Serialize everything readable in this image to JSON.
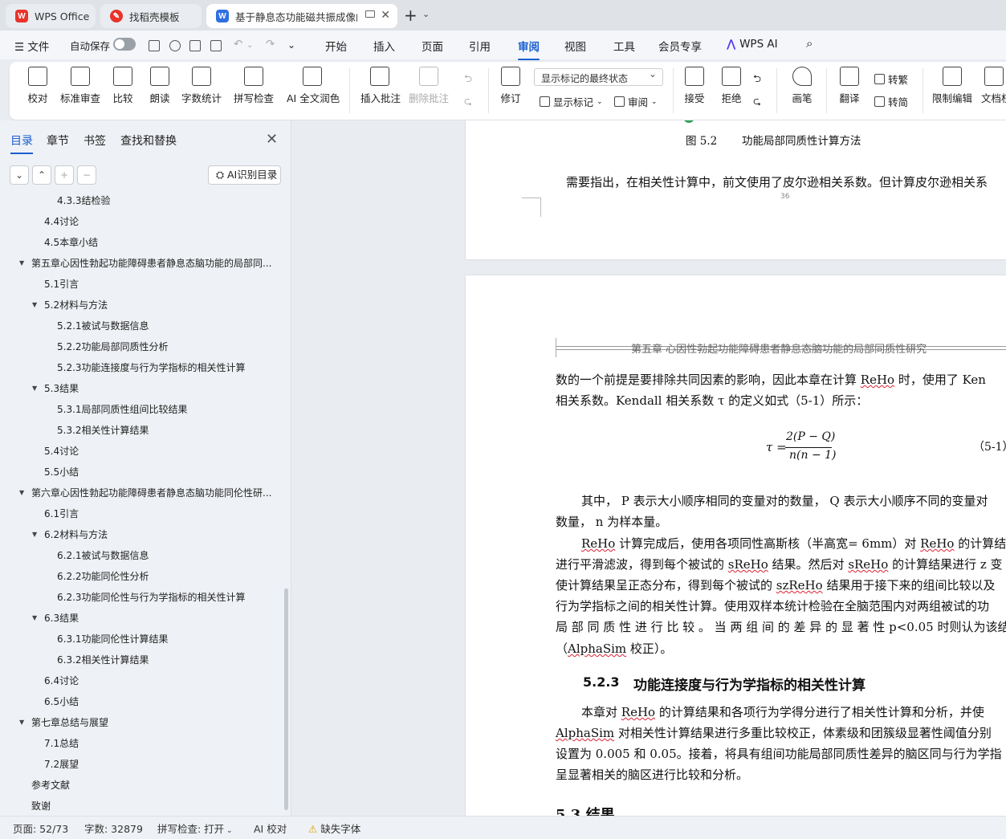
{
  "tabs": {
    "wps": "WPS Office",
    "template": "找稻壳模板",
    "doc": "基于静息态功能磁共振成像的",
    "new": "+"
  },
  "menu": {
    "file": "文件",
    "autosave": "自动保存",
    "items": [
      "开始",
      "插入",
      "页面",
      "引用",
      "审阅",
      "视图",
      "工具",
      "会员专享"
    ],
    "ai": "WPS AI"
  },
  "ribbon": {
    "proof": "校对",
    "std": "标准审查",
    "compare": "比较",
    "read": "朗读",
    "wordcount": "字数统计",
    "spell": "拼写检查",
    "ai_polish": "AI 全文润色",
    "insert_comment": "插入批注",
    "delete_comment": "删除批注",
    "track": "修订",
    "show_state": "显示标记的最终状态",
    "show_marks": "显示标记",
    "review": "审阅",
    "accept": "接受",
    "reject": "拒绝",
    "pen": "画笔",
    "translate": "翻译",
    "to_trad": "转繁",
    "to_simp": "转简",
    "restrict": "限制编辑",
    "protect": "文档权"
  },
  "sidebar": {
    "tabs": [
      "目录",
      "章节",
      "书签",
      "查找和替换"
    ],
    "ai_btn": "AI识别目录",
    "toc": [
      {
        "text": "4.3.3结检验",
        "level": 3
      },
      {
        "text": "4.4讨论",
        "level": 2
      },
      {
        "text": "4.5本章小结",
        "level": 2
      },
      {
        "text": "第五章心因性勃起功能障碍患者静息态脑功能的局部同...",
        "level": 1,
        "exp": true
      },
      {
        "text": "5.1引言",
        "level": 2
      },
      {
        "text": "5.2材料与方法",
        "level": 2,
        "exp": true
      },
      {
        "text": "5.2.1被试与数据信息",
        "level": 3
      },
      {
        "text": "5.2.2功能局部同质性分析",
        "level": 3
      },
      {
        "text": "5.2.3功能连接度与行为学指标的相关性计算",
        "level": 3
      },
      {
        "text": "5.3结果",
        "level": 2,
        "exp": true
      },
      {
        "text": "5.3.1局部同质性组间比较结果",
        "level": 3
      },
      {
        "text": "5.3.2相关性计算结果",
        "level": 3
      },
      {
        "text": "5.4讨论",
        "level": 2
      },
      {
        "text": "5.5小结",
        "level": 2
      },
      {
        "text": "第六章心因性勃起功能障碍患者静息态脑功能同伦性研...",
        "level": 1,
        "exp": true
      },
      {
        "text": "6.1引言",
        "level": 2
      },
      {
        "text": "6.2材料与方法",
        "level": 2,
        "exp": true
      },
      {
        "text": "6.2.1被试与数据信息",
        "level": 3
      },
      {
        "text": "6.2.2功能同伦性分析",
        "level": 3
      },
      {
        "text": "6.2.3功能同伦性与行为学指标的相关性计算",
        "level": 3
      },
      {
        "text": "6.3结果",
        "level": 2,
        "exp": true
      },
      {
        "text": "6.3.1功能同伦性计算结果",
        "level": 3
      },
      {
        "text": "6.3.2相关性计算结果",
        "level": 3
      },
      {
        "text": "6.4讨论",
        "level": 2
      },
      {
        "text": "6.5小结",
        "level": 2
      },
      {
        "text": "第七章总结与展望",
        "level": 1,
        "exp": true
      },
      {
        "text": "7.1总结",
        "level": 2
      },
      {
        "text": "7.2展望",
        "level": 2
      },
      {
        "text": "参考文献",
        "level": 1
      },
      {
        "text": "致谢",
        "level": 1
      }
    ]
  },
  "page1": {
    "fig_label": "图 5.2",
    "fig_title": "功能局部同质性计算方法",
    "para": "需要指出，在相关性计算中，前文使用了皮尔逊相关系数。但计算皮尔逊相关系",
    "page_num": "36"
  },
  "page2": {
    "header": "第五章 心因性勃起功能障碍患者静息态脑功能的局部同质性研究",
    "l1a": "数的一个前提是要排除共同因素的影响，因此本章在计算 ",
    "l1b": "ReHo",
    "l1c": " 时，使用了 Ken",
    "l2": "相关系数。Kendall 相关系数 τ 的定义如式（5-1）所示：",
    "eq_lhs": "τ =",
    "eq_num": "2(P − Q)",
    "eq_den": "n(n − 1)",
    "eq_label": "（5-1）",
    "p1a": "其中，  P 表示大小顺序相同的变量对的数量，  Q 表示大小顺序不同的变量对",
    "p1b": "数量，  n 为样本量。",
    "p2a1": "ReHo",
    "p2a2": " 计算完成后，使用各项同性高斯核（半高宽= 6mm）对 ",
    "p2a3": "ReHo",
    "p2a4": " 的计算结",
    "p2b1": "进行平滑滤波，得到每个被试的 ",
    "p2b2": "sReHo",
    "p2b3": " 结果。然后对 ",
    "p2b4": "sReHo",
    "p2b5": " 的计算结果进行 z 变",
    "p2c1": "使计算结果呈正态分布，得到每个被试的 ",
    "p2c2": "szReHo",
    "p2c3": " 结果用于接下来的组间比较以及",
    "p2d": "行为学指标之间的相关性计算。使用双样本统计检验在全脑范围内对两组被试的功",
    "p2e": "局 部 同 质 性 进 行 比 较 。 当 两 组 间 的 差 异 的 显 著 性  p<0.05  时则认为该结果显",
    "p2f1": "（",
    "p2f2": "AlphaSim",
    "p2f3": " 校正）。",
    "h_num": "5.2.3",
    "h_title": "功能连接度与行为学指标的相关性计算",
    "p3a1": "本章对 ",
    "p3a2": "ReHo",
    "p3a3": " 的计算结果和各项行为学得分进行了相关性计算和分析，并使",
    "p3b1": "AlphaSim",
    "p3b2": " 对相关性计算结果进行多重比较校正，体素级和团簇级显著性阈值分别",
    "p3c": "设置为 0.005 和 0.05。接着，将具有组间功能局部同质性差异的脑区同与行为学指",
    "p3d": "呈显著相关的脑区进行比较和分析。",
    "next_heading": "5.3 结果"
  },
  "status": {
    "page": "页面: 52/73",
    "words": "字数: 32879",
    "spell": "拼写检查: 打开",
    "ai": "AI 校对",
    "font": "缺失字体"
  },
  "colors": {
    "accent": "#1b5fd0",
    "wps_red": "#e8342a",
    "doc_blue": "#2f6fe0",
    "wavy": "#dd2222"
  }
}
